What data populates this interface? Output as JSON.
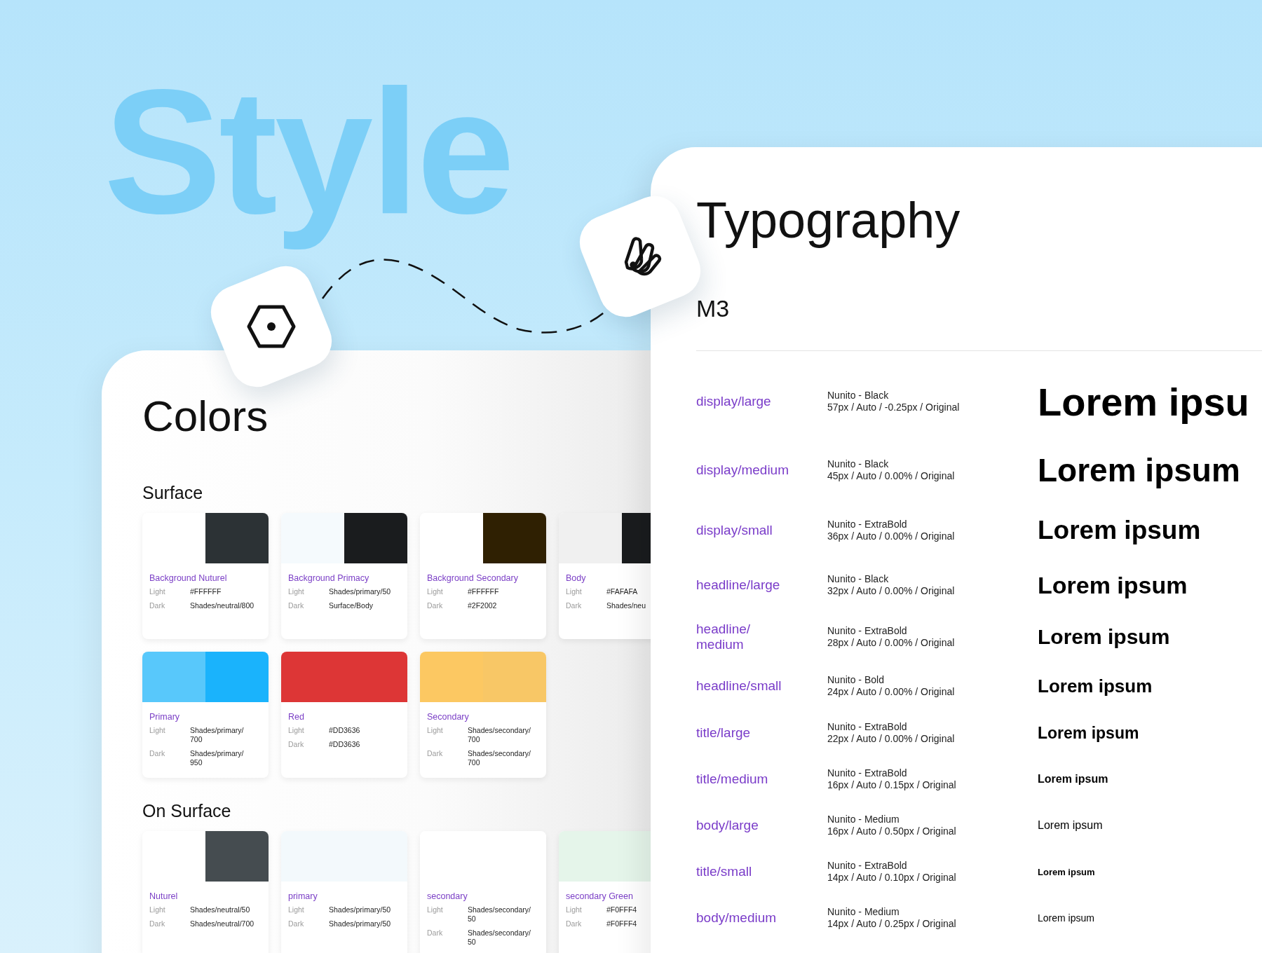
{
  "hero_title": "Style",
  "colors": {
    "title": "Colors",
    "sections": [
      {
        "title": "Surface",
        "cards": [
          {
            "name": "Background Nuturel",
            "swatches": [
              {
                "color": "#ffffff"
              },
              {
                "color": "#2c3235"
              }
            ],
            "rows": [
              {
                "label": "Light",
                "value": "#FFFFFF"
              },
              {
                "label": "Dark",
                "value": "Shades/neutral/800"
              }
            ]
          },
          {
            "name": "Background Primacy",
            "swatches": [
              {
                "color": "#f5fafd"
              },
              {
                "color": "#1a1c1e"
              }
            ],
            "rows": [
              {
                "label": "Light",
                "value": "Shades/primary/50"
              },
              {
                "label": "Dark",
                "value": "Surface/Body"
              }
            ]
          },
          {
            "name": "Background Secondary",
            "swatches": [
              {
                "color": "#ffffff"
              },
              {
                "color": "#2f2002"
              }
            ],
            "rows": [
              {
                "label": "Light",
                "value": "#FFFFFF"
              },
              {
                "label": "Dark",
                "value": "#2F2002"
              }
            ]
          },
          {
            "name": "Body",
            "swatches": [
              {
                "color": "#f0f0f0"
              },
              {
                "color": "#1a1c1e"
              }
            ],
            "rows": [
              {
                "label": "Light",
                "value": "#FAFAFA"
              },
              {
                "label": "Dark",
                "value": "Shades/neu"
              }
            ]
          },
          {
            "name": "Primary",
            "swatches": [
              {
                "color": "#58c8fb"
              },
              {
                "color": "#1ab3fc"
              }
            ],
            "rows": [
              {
                "label": "Light",
                "value": "Shades/primary/700"
              },
              {
                "label": "Dark",
                "value": "Shades/primary/950"
              }
            ]
          },
          {
            "name": "Red",
            "swatches": [
              {
                "color": "#dd3636"
              },
              {
                "color": "#dd3636"
              }
            ],
            "rows": [
              {
                "label": "Light",
                "value": "#DD3636"
              },
              {
                "label": "Dark",
                "value": "#DD3636"
              }
            ]
          },
          {
            "name": "Secondary",
            "swatches": [
              {
                "color": "#fcc862"
              },
              {
                "color": "#f8c766"
              }
            ],
            "rows": [
              {
                "label": "Light",
                "value": "Shades/secondary/700"
              },
              {
                "label": "Dark",
                "value": "Shades/secondary/700"
              }
            ]
          }
        ]
      },
      {
        "title": "On Surface",
        "cards": [
          {
            "name": "Nuturel",
            "swatches": [
              {
                "color": "#ffffff"
              },
              {
                "color": "#454c50"
              }
            ],
            "rows": [
              {
                "label": "Light",
                "value": "Shades/neutral/50"
              },
              {
                "label": "Dark",
                "value": "Shades/neutral/700"
              }
            ]
          },
          {
            "name": "primary",
            "swatches": [
              {
                "color": "#f3f9fc"
              },
              {
                "color": "#f3f9fc"
              }
            ],
            "rows": [
              {
                "label": "Light",
                "value": "Shades/primary/50"
              },
              {
                "label": "Dark",
                "value": "Shades/primary/50"
              }
            ]
          },
          {
            "name": "secondary",
            "swatches": [
              {
                "color": "#ffffff"
              },
              {
                "color": "#ffffff"
              }
            ],
            "rows": [
              {
                "label": "Light",
                "value": "Shades/secondary/50"
              },
              {
                "label": "Dark",
                "value": "Shades/secondary/50"
              }
            ]
          },
          {
            "name": "secondary Green",
            "swatches": [
              {
                "color": "#e5f5ea"
              },
              {
                "color": "#e5f5ea"
              }
            ],
            "rows": [
              {
                "label": "Light",
                "value": "#F0FFF4"
              },
              {
                "label": "Dark",
                "value": "#F0FFF4"
              }
            ]
          }
        ]
      }
    ]
  },
  "typography": {
    "title": "Typography",
    "subtitle": "M3",
    "styles": [
      {
        "name": "display/large",
        "font": "Nunito - Black",
        "spec": "57px / Auto / -0.25px / Original",
        "sample": "Lorem ipsu"
      },
      {
        "name": "display/medium",
        "font": "Nunito - Black",
        "spec": "45px / Auto / 0.00% / Original",
        "sample": "Lorem ipsum"
      },
      {
        "name": "display/small",
        "font": "Nunito - ExtraBold",
        "spec": "36px / Auto / 0.00% / Original",
        "sample": "Lorem ipsum"
      },
      {
        "name": "headline/large",
        "font": "Nunito - Black",
        "spec": "32px / Auto / 0.00% / Original",
        "sample": "Lorem ipsum"
      },
      {
        "name": "headline/medium",
        "font": "Nunito - ExtraBold",
        "spec": "28px / Auto / 0.00% / Original",
        "sample": "Lorem ipsum"
      },
      {
        "name": "headline/small",
        "font": "Nunito - Bold",
        "spec": "24px / Auto / 0.00% / Original",
        "sample": "Lorem ipsum"
      },
      {
        "name": "title/large",
        "font": "Nunito - ExtraBold",
        "spec": "22px / Auto / 0.00% / Original",
        "sample": "Lorem ipsum"
      },
      {
        "name": "title/medium",
        "font": "Nunito - ExtraBold",
        "spec": "16px / Auto / 0.15px / Original",
        "sample": "Lorem ipsum"
      },
      {
        "name": "body/large",
        "font": "Nunito - Medium",
        "spec": "16px / Auto / 0.50px / Original",
        "sample": "Lorem ipsum"
      },
      {
        "name": "title/small",
        "font": "Nunito - ExtraBold",
        "spec": "14px / Auto / 0.10px / Original",
        "sample": "Lorem ipsum"
      },
      {
        "name": "body/medium",
        "font": "Nunito - Medium",
        "spec": "14px / Auto / 0.25px / Original",
        "sample": "Lorem ipsum"
      }
    ]
  }
}
